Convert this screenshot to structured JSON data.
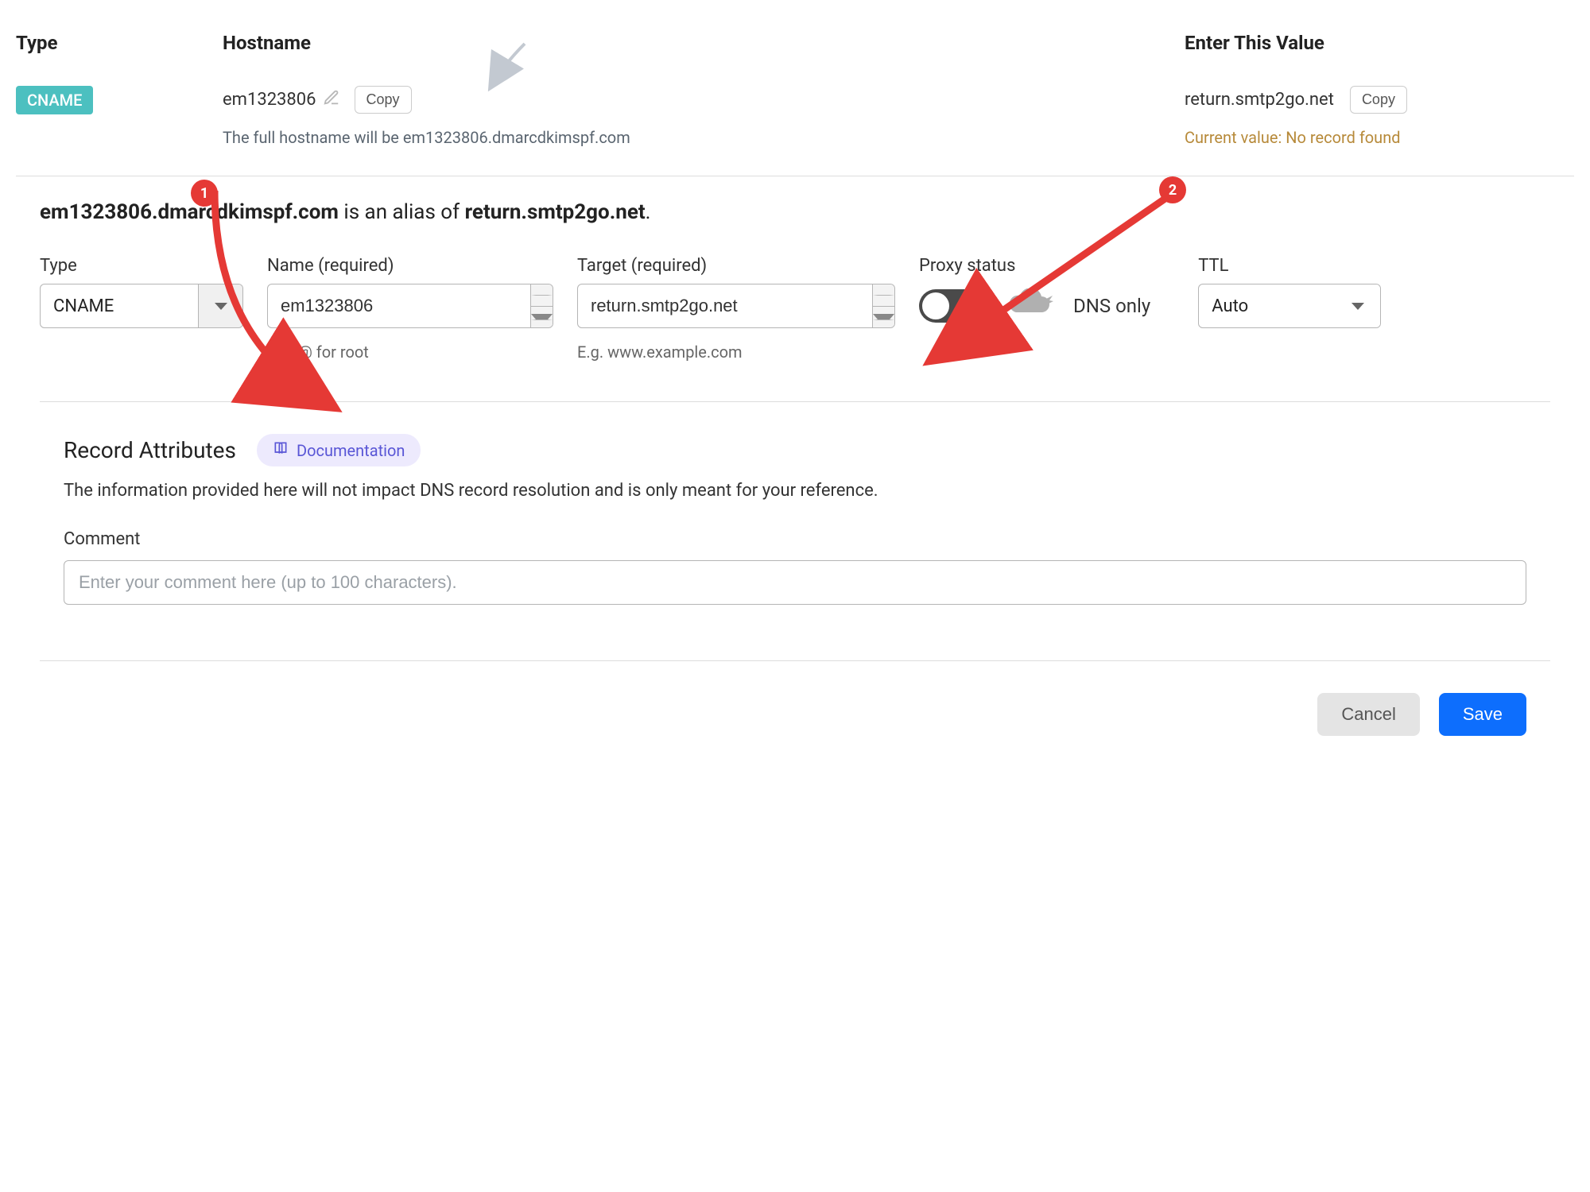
{
  "top": {
    "headers": {
      "type": "Type",
      "hostname": "Hostname",
      "value": "Enter This Value"
    },
    "badge": "CNAME",
    "hostname": "em1323806",
    "copy_label": "Copy",
    "full_hostname_hint": "The full hostname will be em1323806.dmarcdkimspf.com",
    "value": "return.smtp2go.net",
    "current_value": "Current value: No record found"
  },
  "alias": {
    "host": "em1323806.dmarcdkimspf.com",
    "mid": " is an alias of ",
    "target": "return.smtp2go.net",
    "end": "."
  },
  "form": {
    "type": {
      "label": "Type",
      "value": "CNAME"
    },
    "name": {
      "label": "Name (required)",
      "value": "em1323806",
      "hint": "Use @ for root"
    },
    "target": {
      "label": "Target (required)",
      "value": "return.smtp2go.net",
      "hint": "E.g. www.example.com"
    },
    "proxy": {
      "label": "Proxy status",
      "status_text": "DNS only",
      "on": false
    },
    "ttl": {
      "label": "TTL",
      "value": "Auto"
    }
  },
  "attributes": {
    "title": "Record Attributes",
    "doc_label": "Documentation",
    "description": "The information provided here will not impact DNS record resolution and is only meant for your reference.",
    "comment_label": "Comment",
    "comment_placeholder": "Enter your comment here (up to 100 characters)."
  },
  "footer": {
    "cancel": "Cancel",
    "save": "Save"
  },
  "annotations": {
    "b1": "1",
    "b2": "2"
  }
}
